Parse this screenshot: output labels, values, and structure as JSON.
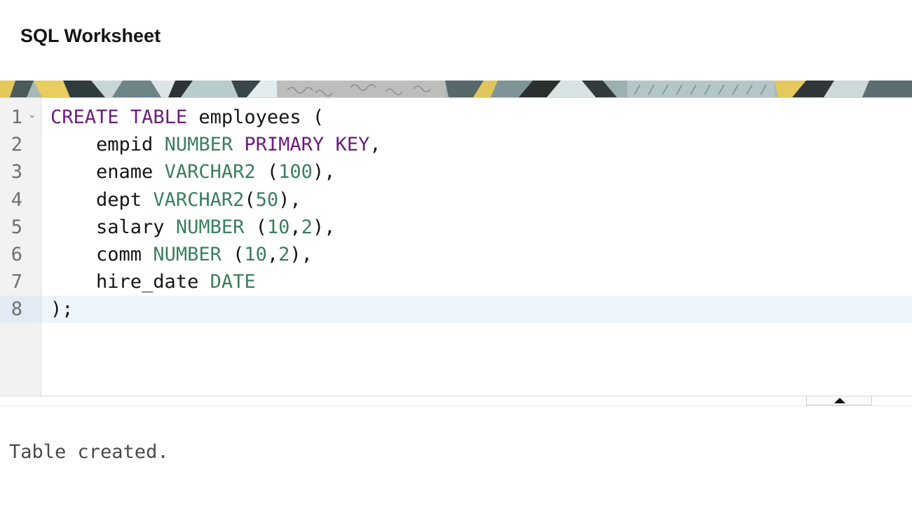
{
  "header": {
    "title": "SQL Worksheet"
  },
  "banner": {
    "icon": "decorative-pattern"
  },
  "editor": {
    "line_numbers": [
      "1",
      "2",
      "3",
      "4",
      "5",
      "6",
      "7",
      "8"
    ],
    "active_line": 8,
    "fold_icon": "⌄",
    "lines": [
      [
        {
          "t": "CREATE",
          "c": "kw"
        },
        {
          "t": " "
        },
        {
          "t": "TABLE",
          "c": "kw"
        },
        {
          "t": " employees ("
        }
      ],
      [
        {
          "t": "    empid "
        },
        {
          "t": "NUMBER",
          "c": "ty"
        },
        {
          "t": " "
        },
        {
          "t": "PRIMARY",
          "c": "kw"
        },
        {
          "t": " "
        },
        {
          "t": "KEY",
          "c": "kw"
        },
        {
          "t": ","
        }
      ],
      [
        {
          "t": "    ename "
        },
        {
          "t": "VARCHAR2",
          "c": "ty"
        },
        {
          "t": " ("
        },
        {
          "t": "100",
          "c": "num"
        },
        {
          "t": "),"
        }
      ],
      [
        {
          "t": "    dept "
        },
        {
          "t": "VARCHAR2",
          "c": "ty"
        },
        {
          "t": "("
        },
        {
          "t": "50",
          "c": "num"
        },
        {
          "t": "),"
        }
      ],
      [
        {
          "t": "    salary "
        },
        {
          "t": "NUMBER",
          "c": "ty"
        },
        {
          "t": " ("
        },
        {
          "t": "10",
          "c": "num"
        },
        {
          "t": ","
        },
        {
          "t": "2",
          "c": "num"
        },
        {
          "t": "),"
        }
      ],
      [
        {
          "t": "    comm "
        },
        {
          "t": "NUMBER",
          "c": "ty"
        },
        {
          "t": " ("
        },
        {
          "t": "10",
          "c": "num"
        },
        {
          "t": ","
        },
        {
          "t": "2",
          "c": "num"
        },
        {
          "t": "),"
        }
      ],
      [
        {
          "t": "    hire_date "
        },
        {
          "t": "DATE",
          "c": "ty"
        }
      ],
      [
        {
          "t": ");"
        }
      ]
    ]
  },
  "splitter": {
    "toggle_icon": "caret-up-icon"
  },
  "output": {
    "text": "Table created."
  },
  "colors": {
    "keyword": "#6c1c80",
    "type": "#3b7f5e",
    "active_line": "#eef5fc"
  }
}
